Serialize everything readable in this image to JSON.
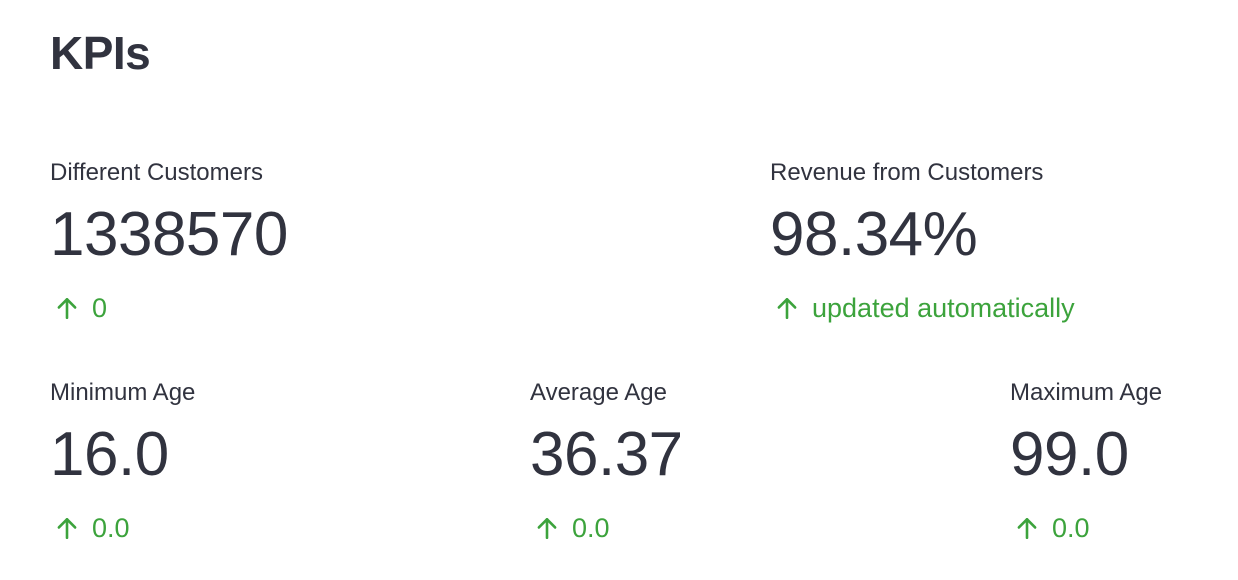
{
  "page": {
    "title": "KPIs"
  },
  "colors": {
    "text": "#31333f",
    "delta_positive": "#3ca33c",
    "background": "#ffffff"
  },
  "metrics": {
    "customers": {
      "label": "Different Customers",
      "value": "1338570",
      "delta": "0",
      "delta_icon": "arrow-up-icon"
    },
    "revenue": {
      "label": "Revenue from Customers",
      "value": "98.34%",
      "delta": "updated automatically",
      "delta_icon": "arrow-up-icon"
    },
    "min_age": {
      "label": "Minimum Age",
      "value": "16.0",
      "delta": "0.0",
      "delta_icon": "arrow-up-icon"
    },
    "avg_age": {
      "label": "Average Age",
      "value": "36.37",
      "delta": "0.0",
      "delta_icon": "arrow-up-icon"
    },
    "max_age": {
      "label": "Maximum Age",
      "value": "99.0",
      "delta": "0.0",
      "delta_icon": "arrow-up-icon"
    }
  }
}
